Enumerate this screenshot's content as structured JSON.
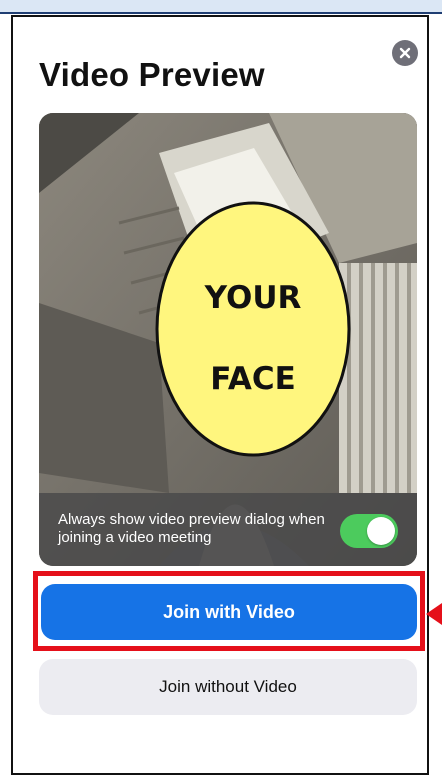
{
  "title": "Video Preview",
  "preview": {
    "face_placeholder_line1": "YOUR",
    "face_placeholder_line2": "FACE"
  },
  "settings": {
    "always_show_label": "Always show video preview dialog when joining a video meeting",
    "always_show_enabled": true
  },
  "buttons": {
    "join_with_video": "Join with Video",
    "join_without_video": "Join without Video"
  },
  "colors": {
    "primary_blue": "#1673e6",
    "toggle_green": "#4ccb5d",
    "highlight_red": "#e5101a",
    "secondary_button": "#ececf1"
  },
  "icons": {
    "close": "close-icon",
    "callout_arrow": "arrow-left-icon"
  }
}
